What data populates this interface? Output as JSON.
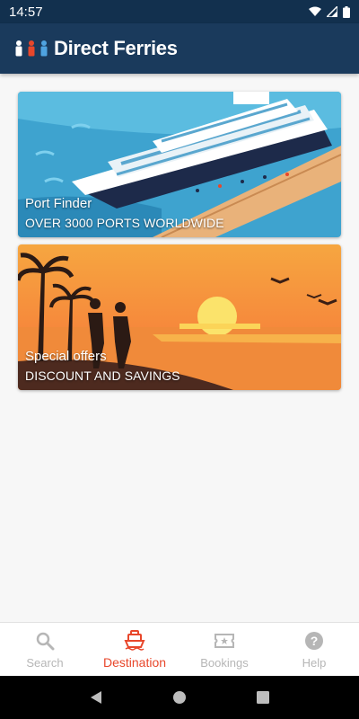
{
  "status_bar": {
    "time": "14:57"
  },
  "app_bar": {
    "logo_text": "Direct Ferries"
  },
  "cards": [
    {
      "title": "Port Finder",
      "subtitle": "OVER 3000 PORTS WORLDWIDE"
    },
    {
      "title": "Special offers",
      "subtitle": "DISCOUNT AND SAVINGS"
    }
  ],
  "bottom_nav": {
    "items": [
      {
        "label": "Search",
        "icon": "search-icon"
      },
      {
        "label": "Destination",
        "icon": "ship-icon"
      },
      {
        "label": "Bookings",
        "icon": "ticket-icon"
      },
      {
        "label": "Help",
        "icon": "help-icon"
      }
    ],
    "active": "Destination"
  },
  "colors": {
    "app_bar": "#1a3a5c",
    "accent": "#e8472b",
    "inactive": "#b6b6b6"
  }
}
